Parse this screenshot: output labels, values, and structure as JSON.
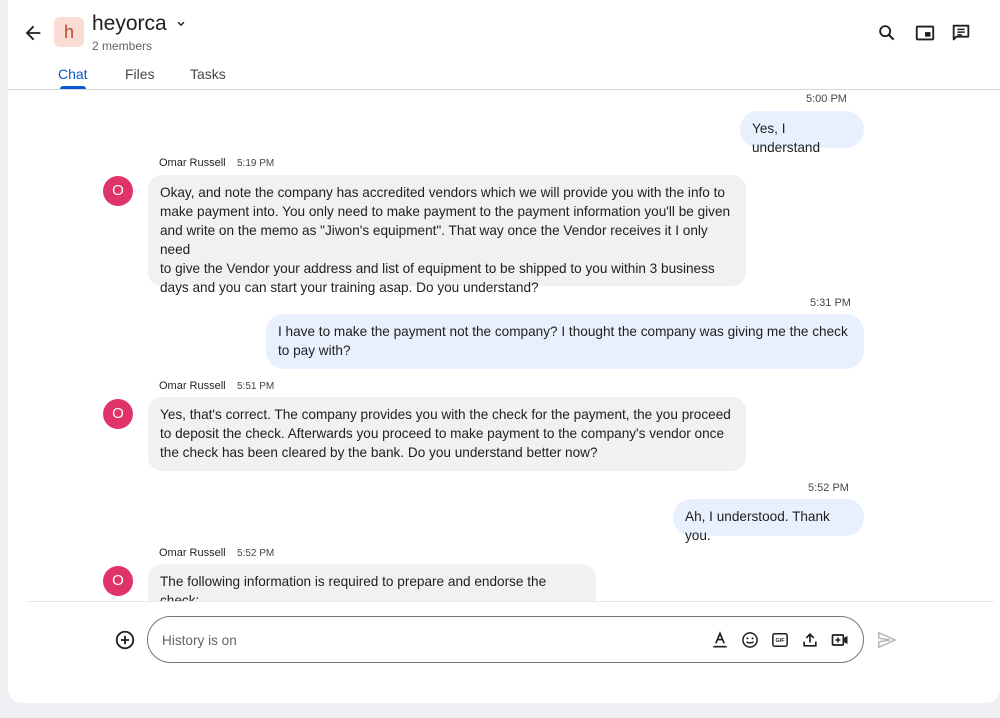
{
  "header": {
    "space_initial": "h",
    "space_name": "heyorca",
    "members": "2 members",
    "icons": [
      "back-arrow-icon",
      "chevron-down-icon",
      "search-icon",
      "picture-in-picture-icon",
      "threads-icon"
    ]
  },
  "tabs": [
    {
      "label": "Chat",
      "active": true
    },
    {
      "label": "Files",
      "active": false
    },
    {
      "label": "Tasks",
      "active": false
    }
  ],
  "messages": [
    {
      "direction": "out",
      "time": "5:00 PM",
      "text": "Yes, I understand"
    },
    {
      "direction": "in",
      "sender": "Omar Russell",
      "avatar_initial": "O",
      "time": "5:19 PM",
      "lines": [
        "Okay, and note the company has accredited vendors which we will provide you with the info to",
        "make payment into. You only need to make payment to the payment information you'll be given",
        "and write on the memo as \"Jiwon's equipment\". That way once the Vendor receives it I only need",
        "to give the Vendor your address and list of equipment to be shipped to you within 3 business",
        "days and you can start your training asap. Do you understand?"
      ]
    },
    {
      "direction": "out",
      "time": "5:31 PM",
      "lines": [
        "I have to make the payment not the company? I thought the company was giving me the check",
        "to pay with?"
      ]
    },
    {
      "direction": "in",
      "sender": "Omar Russell",
      "avatar_initial": "O",
      "time": "5:51 PM",
      "lines": [
        "Yes, that's correct. The company provides you with the check for the payment, the you proceed",
        "to deposit the check. Afterwards you proceed to make payment to the company's vendor once",
        "the check has been cleared by the bank. Do you understand better now?"
      ]
    },
    {
      "direction": "out",
      "time": "5:52 PM",
      "text": "Ah, I understood. Thank you."
    },
    {
      "direction": "in",
      "sender": "Omar Russell",
      "avatar_initial": "O",
      "time": "5:52 PM",
      "text": "The following information is required to prepare and endorse the check:"
    }
  ],
  "composer": {
    "placeholder": "History is on",
    "icons": [
      "add-circle-icon",
      "text-format-icon",
      "emoji-icon",
      "gif-icon",
      "upload-icon",
      "video-meeting-icon",
      "send-icon"
    ]
  },
  "colors": {
    "accent": "#0b57d0",
    "outgoing_bubble": "#e8f0fe",
    "incoming_bubble": "#f1f1f1",
    "avatar": "#e0336a",
    "space_avatar_bg": "#f9dcd4"
  }
}
